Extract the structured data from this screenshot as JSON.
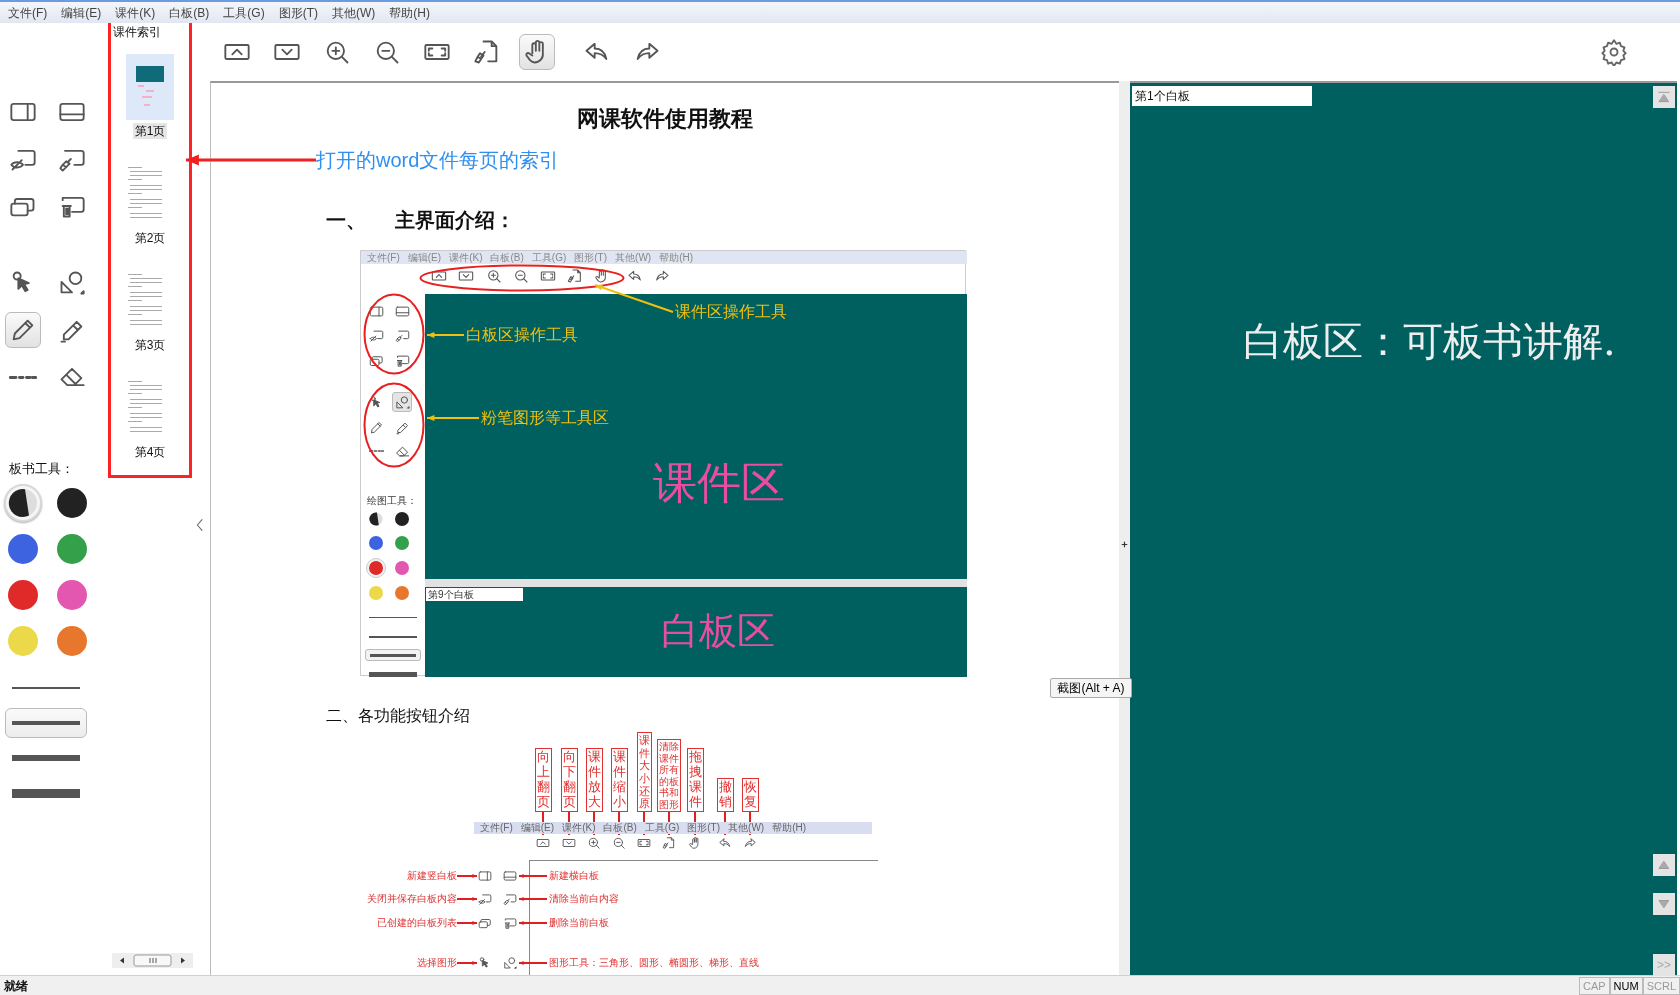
{
  "menu": [
    "文件(F)",
    "编辑(E)",
    "课件(K)",
    "白板(B)",
    "工具(G)",
    "图形(T)",
    "其他(W)",
    "帮助(H)"
  ],
  "toolbar": [
    {
      "kind": "page-up",
      "selected": false
    },
    {
      "kind": "page-down",
      "selected": false
    },
    {
      "kind": "zoom-in",
      "selected": false
    },
    {
      "kind": "zoom-out",
      "selected": false
    },
    {
      "kind": "fit",
      "selected": false
    },
    {
      "kind": "clear",
      "selected": false
    },
    {
      "kind": "drag",
      "selected": true
    },
    {
      "kind": "undo",
      "selected": false
    },
    {
      "kind": "redo",
      "selected": false
    }
  ],
  "board_tools": [
    {
      "kind": "board-vertical",
      "selected": false
    },
    {
      "kind": "board-horizontal",
      "selected": false
    },
    {
      "kind": "board-close",
      "selected": false
    },
    {
      "kind": "board-clear",
      "selected": false
    },
    {
      "kind": "board-list",
      "selected": false
    },
    {
      "kind": "board-delete",
      "selected": false
    },
    {
      "kind": "select",
      "selected": false
    },
    {
      "kind": "shapes",
      "selected": false
    },
    {
      "kind": "chalk",
      "selected": true
    },
    {
      "kind": "highlighter",
      "selected": false
    },
    {
      "kind": "dash",
      "selected": false
    },
    {
      "kind": "eraser",
      "selected": false
    }
  ],
  "board_tools_label": "板书工具：",
  "colors": [
    {
      "kind": "auto",
      "selected": true
    },
    {
      "kind": "swatch",
      "color": "#222222",
      "selected": false
    },
    {
      "kind": "swatch",
      "color": "#3d63e0",
      "selected": false
    },
    {
      "kind": "swatch",
      "color": "#35a04a",
      "selected": false
    },
    {
      "kind": "swatch",
      "color": "#e02a2a",
      "selected": false
    },
    {
      "kind": "swatch",
      "color": "#e457b0",
      "selected": false
    },
    {
      "kind": "swatch",
      "color": "#ecd94a",
      "selected": false
    },
    {
      "kind": "swatch",
      "color": "#e8772e",
      "selected": false
    }
  ],
  "line_widths": [
    {
      "kind": "thin",
      "selected": false
    },
    {
      "kind": "medium",
      "selected": true
    },
    {
      "kind": "thick",
      "selected": false
    },
    {
      "kind": "heavy",
      "selected": false
    }
  ],
  "index": {
    "title": "课件索引",
    "pages": [
      {
        "label": "第1页",
        "kind": "figure",
        "selected": true
      },
      {
        "label": "第2页",
        "kind": "text",
        "selected": false
      },
      {
        "label": "第3页",
        "kind": "text",
        "selected": false
      },
      {
        "label": "第4页",
        "kind": "text",
        "selected": false
      }
    ]
  },
  "document": {
    "title": "网课软件使用教程",
    "annotation": "打开的word文件每页的索引",
    "section_1": {
      "number": "一、",
      "heading": "主界面介绍："
    },
    "figure_1": {
      "menu": [
        "文件(F)",
        "编辑(E)",
        "课件(K)",
        "白板(B)",
        "工具(G)",
        "图形(T)",
        "其他(W)",
        "帮助(H)"
      ],
      "toolbar": [
        {
          "kind": "page-up"
        },
        {
          "kind": "page-down"
        },
        {
          "kind": "zoom-in"
        },
        {
          "kind": "zoom-out"
        },
        {
          "kind": "fit"
        },
        {
          "kind": "clear"
        },
        {
          "kind": "drag"
        },
        {
          "kind": "undo"
        },
        {
          "kind": "redo"
        }
      ],
      "board_tools": [
        {
          "kind": "board-vertical",
          "selected": false
        },
        {
          "kind": "board-horizontal",
          "selected": false
        },
        {
          "kind": "board-close",
          "selected": false
        },
        {
          "kind": "board-clear",
          "selected": false
        },
        {
          "kind": "board-list",
          "selected": false
        },
        {
          "kind": "board-delete",
          "selected": false
        },
        {
          "kind": "select",
          "selected": false
        },
        {
          "kind": "shapes",
          "selected": true
        },
        {
          "kind": "chalk",
          "selected": false
        },
        {
          "kind": "highlighter",
          "selected": false
        },
        {
          "kind": "dash",
          "selected": false
        },
        {
          "kind": "eraser",
          "selected": false
        }
      ],
      "tools_label": "绘图工具：",
      "colors": [
        {
          "kind": "auto",
          "selected": false
        },
        {
          "kind": "swatch",
          "color": "#222222",
          "selected": false
        },
        {
          "kind": "swatch",
          "color": "#3d63e0",
          "selected": false
        },
        {
          "kind": "swatch",
          "color": "#35a04a",
          "selected": false
        },
        {
          "kind": "swatch",
          "color": "#e02a2a",
          "selected": true
        },
        {
          "kind": "swatch",
          "color": "#e457b0",
          "selected": false
        },
        {
          "kind": "swatch",
          "color": "#ecd94a",
          "selected": false
        },
        {
          "kind": "swatch",
          "color": "#e8772e",
          "selected": false
        }
      ],
      "line_widths": [
        {
          "kind": "thin",
          "selected": false
        },
        {
          "kind": "medium",
          "selected": false
        },
        {
          "kind": "thick",
          "selected": true
        },
        {
          "kind": "heavy",
          "selected": false
        }
      ],
      "course_area": "课件区",
      "board_label": "第9个白板",
      "board_area": "白板区",
      "callouts": [
        "课件区操作工具",
        "白板区操作工具",
        "粉笔图形等工具区"
      ]
    },
    "section_2": "二、各功能按钮介绍",
    "figure_2": {
      "menu": [
        "文件(F)",
        "编辑(E)",
        "课件(K)",
        "白板(B)",
        "工具(G)",
        "图形(T)",
        "其他(W)",
        "帮助(H)"
      ],
      "top_buttons": [
        {
          "label": "向上翻页",
          "kind": "page-up"
        },
        {
          "label": "向下翻页",
          "kind": "page-down"
        },
        {
          "label": "课件放大",
          "kind": "zoom-in"
        },
        {
          "label": "课件缩小",
          "kind": "zoom-out"
        },
        {
          "label": "课件大小还原",
          "kind": "fit"
        },
        {
          "label": "清除课件所有的板书和图形",
          "kind": "clear"
        },
        {
          "label": "拖拽课件",
          "kind": "drag"
        },
        {
          "label": "撤销",
          "kind": "undo"
        },
        {
          "label": "恢复",
          "kind": "redo"
        }
      ],
      "left_rows": [
        {
          "label": "新建竖白板",
          "kind": "board-vertical"
        },
        {
          "label": "关闭并保存白板内容",
          "kind": "board-close"
        },
        {
          "label": "已创建的白板列表",
          "kind": "board-list"
        },
        {
          "label": "选择图形",
          "kind": "select"
        }
      ],
      "right_rows": [
        {
          "label": "新建横白板",
          "kind": "board-horizontal"
        },
        {
          "label": "清除当前白内容",
          "kind": "board-clear"
        },
        {
          "label": "删除当前白板",
          "kind": "board-delete"
        },
        {
          "label": "图形工具：三角形、圆形、椭圆形、梯形、直线",
          "kind": "shapes"
        }
      ]
    }
  },
  "screenshot_button": "截图(Alt + A)",
  "whiteboard": {
    "label": "第1个白板",
    "handwriting": "白板区：可板书讲解.",
    "more_button": ">>"
  },
  "status_bar": {
    "text": "就绪",
    "indicators": [
      {
        "label": "CAP",
        "on": false
      },
      {
        "label": "NUM",
        "on": true
      },
      {
        "label": "SCRL",
        "on": false
      }
    ]
  }
}
